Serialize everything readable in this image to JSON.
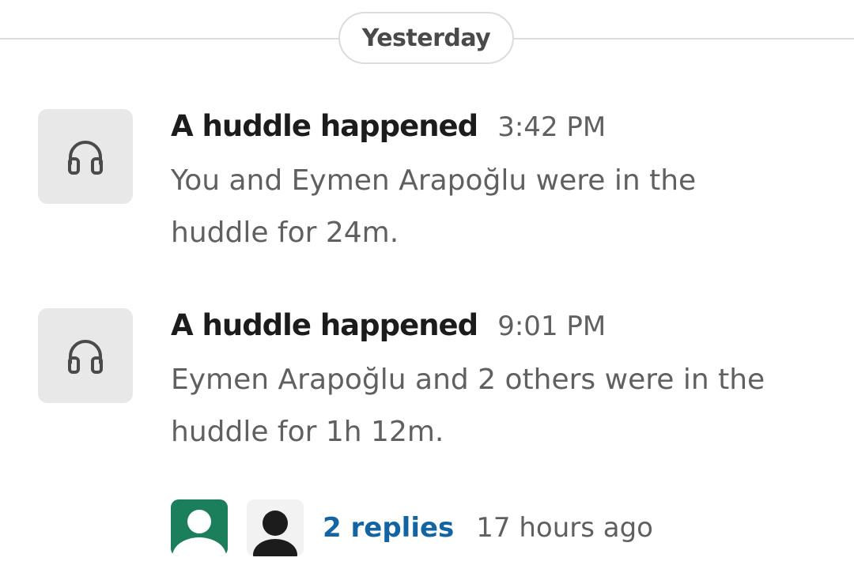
{
  "divider": {
    "date_label": "Yesterday"
  },
  "messages": [
    {
      "icon": "headphones-icon",
      "title": "A huddle happened",
      "time": "3:42 PM",
      "body_line1": "You and Eymen Arapoğlu were in the",
      "body_line2": "huddle for 24m."
    },
    {
      "icon": "headphones-icon",
      "title": "A huddle happened",
      "time": "9:01 PM",
      "body_line1": "Eymen Arapoğlu and 2 others were in the",
      "body_line2": "huddle for 1h 12m."
    }
  ],
  "thread": {
    "replies_label": "2 replies",
    "last_reply": "17 hours ago",
    "avatar_colors": [
      "#1a7f5a",
      "#f2f2f2"
    ]
  }
}
